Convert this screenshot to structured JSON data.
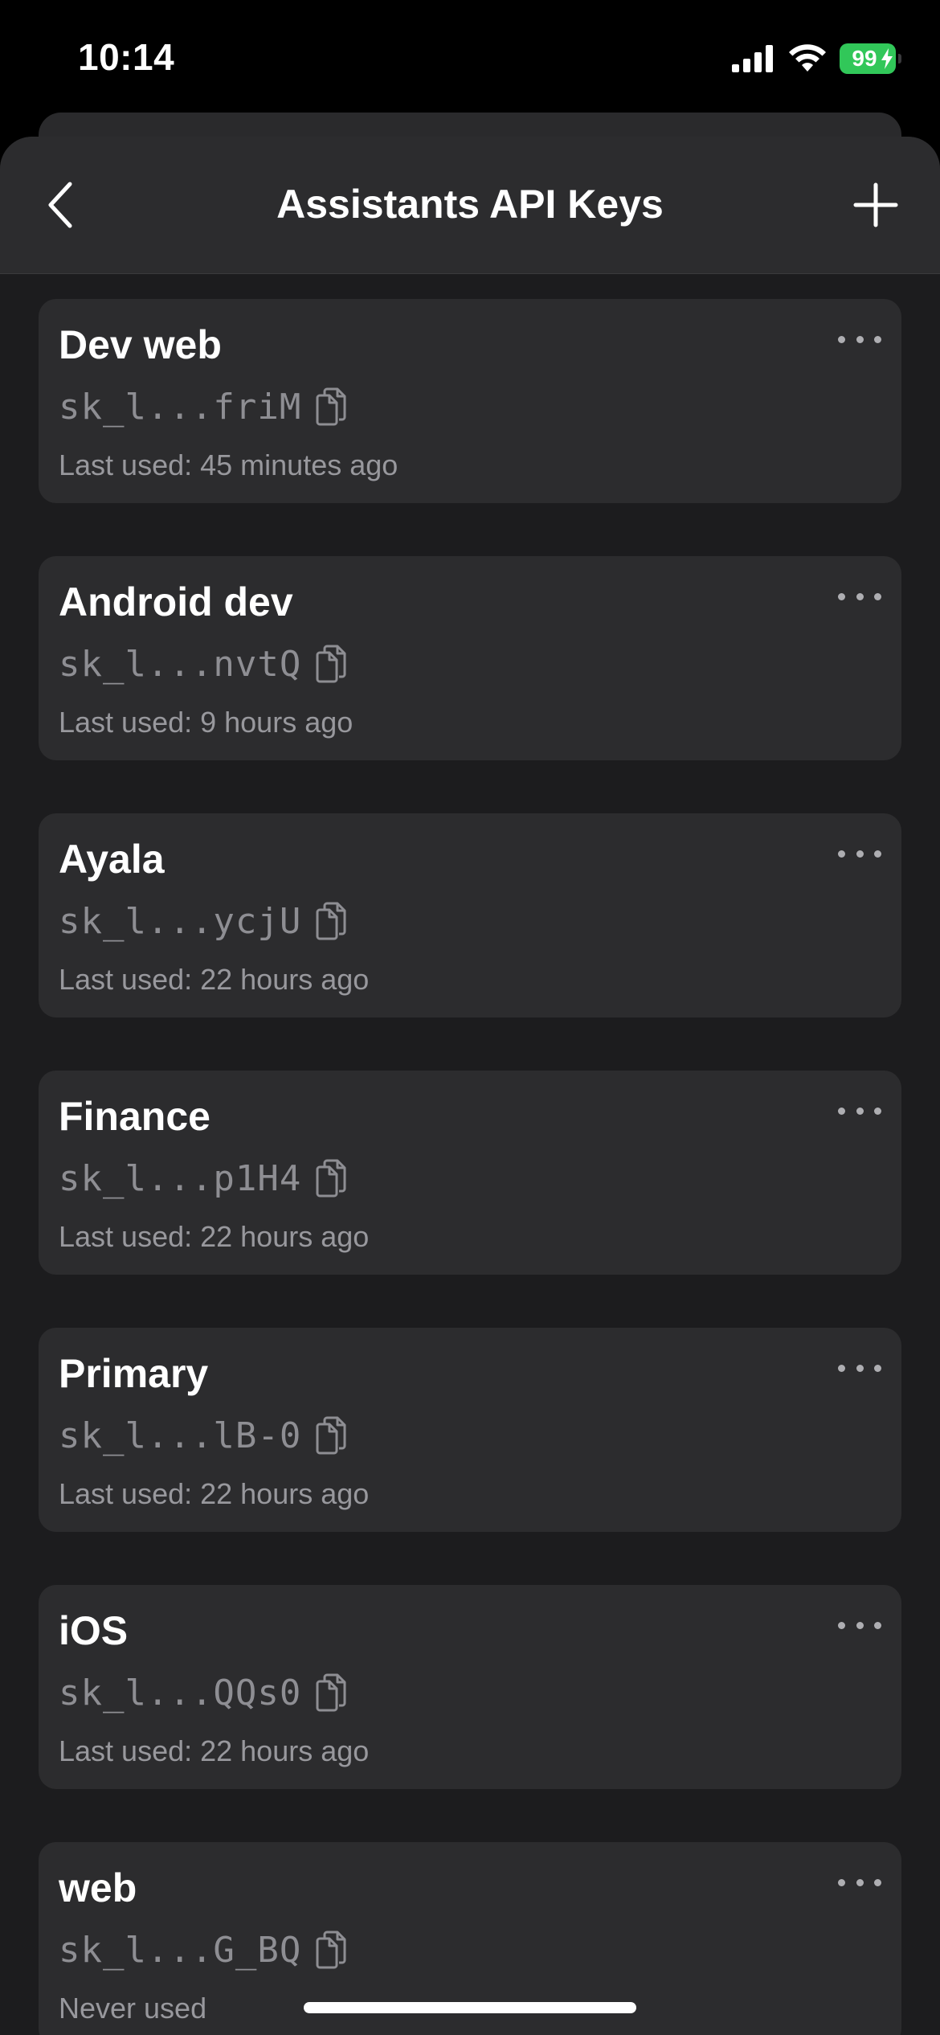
{
  "status_bar": {
    "time": "10:14",
    "battery": "99"
  },
  "nav": {
    "title": "Assistants API Keys"
  },
  "keys": [
    {
      "name": "Dev web",
      "key": "sk_l...friM",
      "last_used": "Last used: 45 minutes ago"
    },
    {
      "name": "Android dev",
      "key": "sk_l...nvtQ",
      "last_used": "Last used: 9 hours ago"
    },
    {
      "name": "Ayala",
      "key": "sk_l...ycjU",
      "last_used": "Last used: 22 hours ago"
    },
    {
      "name": "Finance",
      "key": "sk_l...p1H4",
      "last_used": "Last used: 22 hours ago"
    },
    {
      "name": "Primary",
      "key": "sk_l...lB-0",
      "last_used": "Last used: 22 hours ago"
    },
    {
      "name": "iOS",
      "key": "sk_l...QQs0",
      "last_used": "Last used: 22 hours ago"
    },
    {
      "name": "web",
      "key": "sk_l...G_BQ",
      "last_used": "Never used"
    }
  ],
  "colors": {
    "background": "#1c1c1e",
    "card": "#2c2c2e",
    "battery": "#31c759",
    "secondary_text": "#8e8e93"
  },
  "icons": {
    "back": "chevron-left-icon",
    "add": "plus-icon",
    "copy": "copy-icon",
    "more": "ellipsis-icon"
  }
}
